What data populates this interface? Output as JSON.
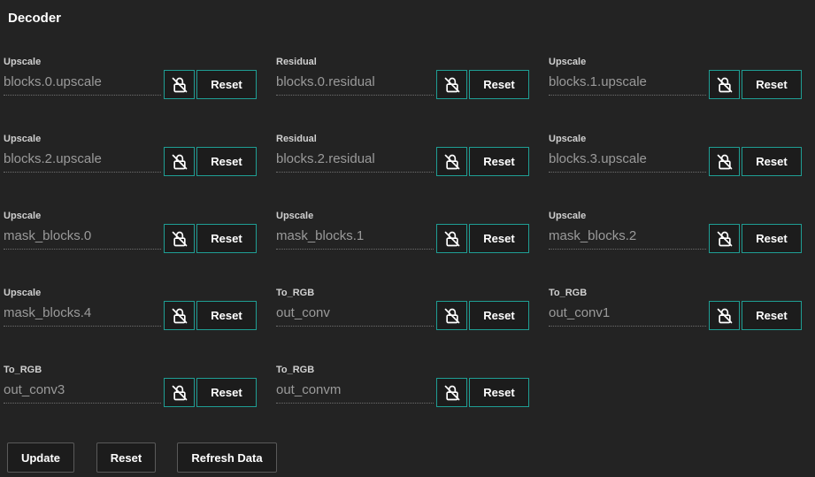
{
  "section": {
    "title": "Decoder"
  },
  "reset_label": "Reset",
  "icons": {
    "lock": "lock-off-icon"
  },
  "accent_color": "#1f9e94",
  "fields": [
    {
      "label": "Upscale",
      "value": "blocks.0.upscale"
    },
    {
      "label": "Residual",
      "value": "blocks.0.residual"
    },
    {
      "label": "Upscale",
      "value": "blocks.1.upscale"
    },
    {
      "label": "Upscale",
      "value": "blocks.2.upscale"
    },
    {
      "label": "Residual",
      "value": "blocks.2.residual"
    },
    {
      "label": "Upscale",
      "value": "blocks.3.upscale"
    },
    {
      "label": "Upscale",
      "value": "mask_blocks.0"
    },
    {
      "label": "Upscale",
      "value": "mask_blocks.1"
    },
    {
      "label": "Upscale",
      "value": "mask_blocks.2"
    },
    {
      "label": "Upscale",
      "value": "mask_blocks.4"
    },
    {
      "label": "To_RGB",
      "value": "out_conv"
    },
    {
      "label": "To_RGB",
      "value": "out_conv1"
    },
    {
      "label": "To_RGB",
      "value": "out_conv3"
    },
    {
      "label": "To_RGB",
      "value": "out_convm"
    }
  ],
  "actions": {
    "update_label": "Update",
    "reset_label": "Reset",
    "refresh_label": "Refresh Data"
  }
}
